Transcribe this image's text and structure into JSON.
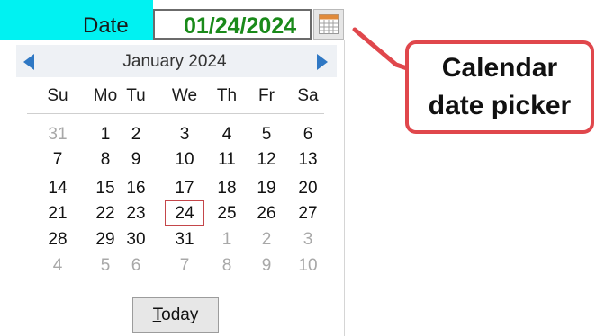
{
  "cell": {
    "label": "Date",
    "value": "01/24/2024",
    "picker_button_icon": "calendar-grid-icon"
  },
  "calendar": {
    "month_title": "January 2024",
    "prev_icon": "triangle-left-icon",
    "next_icon": "triangle-right-icon",
    "weekdays": [
      "Su",
      "Mo",
      "Tu",
      "We",
      "Th",
      "Fr",
      "Sa"
    ],
    "weeks": [
      [
        {
          "d": "31",
          "other": true
        },
        {
          "d": "1"
        },
        {
          "d": "2"
        },
        {
          "d": "3"
        },
        {
          "d": "4"
        },
        {
          "d": "5"
        },
        {
          "d": "6"
        }
      ],
      [
        {
          "d": "7"
        },
        {
          "d": "8"
        },
        {
          "d": "9"
        },
        {
          "d": "10"
        },
        {
          "d": "11"
        },
        {
          "d": "12"
        },
        {
          "d": "13"
        }
      ],
      [
        {
          "d": "14"
        },
        {
          "d": "15"
        },
        {
          "d": "16"
        },
        {
          "d": "17"
        },
        {
          "d": "18"
        },
        {
          "d": "19"
        },
        {
          "d": "20"
        }
      ],
      [
        {
          "d": "21"
        },
        {
          "d": "22"
        },
        {
          "d": "23"
        },
        {
          "d": "24",
          "selected": true
        },
        {
          "d": "25"
        },
        {
          "d": "26"
        },
        {
          "d": "27"
        }
      ],
      [
        {
          "d": "28"
        },
        {
          "d": "29"
        },
        {
          "d": "30"
        },
        {
          "d": "31"
        },
        {
          "d": "1",
          "other": true
        },
        {
          "d": "2",
          "other": true
        },
        {
          "d": "3",
          "other": true
        }
      ],
      [
        {
          "d": "4",
          "other": true
        },
        {
          "d": "5",
          "other": true
        },
        {
          "d": "6",
          "other": true
        },
        {
          "d": "7",
          "other": true
        },
        {
          "d": "8",
          "other": true
        },
        {
          "d": "9",
          "other": true
        },
        {
          "d": "10",
          "other": true
        }
      ]
    ],
    "today_button": {
      "accel": "T",
      "rest": "oday"
    }
  },
  "callout": {
    "line1": "Calendar",
    "line2": "date picker"
  },
  "colors": {
    "cell_highlight": "#00f2f2",
    "date_value": "#1a8a1a",
    "nav_arrow": "#2f78c4",
    "callout_border": "#e0474c",
    "selected_day_border": "#c4464a"
  }
}
